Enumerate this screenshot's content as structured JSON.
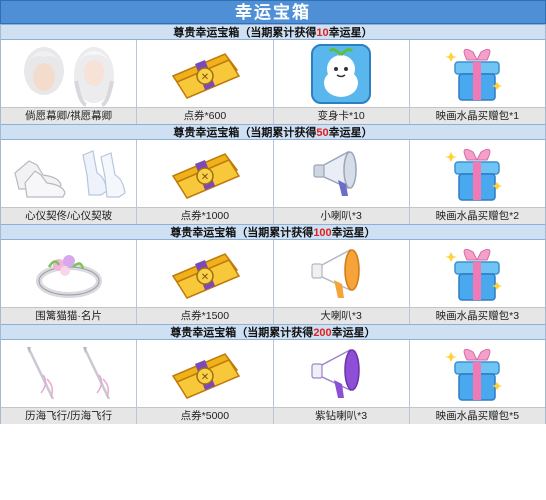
{
  "title": "幸运宝箱",
  "tiers": [
    {
      "header_pre": "尊贵幸运宝箱（当期累计获得",
      "header_num": "10",
      "header_post": "幸运星）",
      "items": [
        {
          "label": "倘愿幕卿/祺愿幕卿",
          "icon": "hair-avatar-icon"
        },
        {
          "label": "点券*600",
          "icon": "gold-voucher-icon"
        },
        {
          "label": "变身卡*10",
          "icon": "transform-card-icon"
        },
        {
          "label": "映画水晶买赠包*1",
          "icon": "gift-box-icon"
        }
      ]
    },
    {
      "header_pre": "尊贵幸运宝箱（当期累计获得",
      "header_num": "50",
      "header_post": "幸运星）",
      "items": [
        {
          "label": "心仪契佟/心仪契玻",
          "icon": "shoes-icon"
        },
        {
          "label": "点券*1000",
          "icon": "gold-voucher-icon"
        },
        {
          "label": "小喇叭*3",
          "icon": "small-megaphone-icon"
        },
        {
          "label": "映画水晶买赠包*2",
          "icon": "gift-box-icon"
        }
      ]
    },
    {
      "header_pre": "尊贵幸运宝箱（当期累计获得",
      "header_num": "100",
      "header_post": "幸运星）",
      "items": [
        {
          "label": "围篱猫猫·名片",
          "icon": "flower-ring-icon"
        },
        {
          "label": "点券*1500",
          "icon": "gold-voucher-icon"
        },
        {
          "label": "大喇叭*3",
          "icon": "large-megaphone-icon"
        },
        {
          "label": "映画水晶买赠包*3",
          "icon": "gift-box-icon"
        }
      ]
    },
    {
      "header_pre": "尊贵幸运宝箱（当期累计获得",
      "header_num": "200",
      "header_post": "幸运星）",
      "items": [
        {
          "label": "历海飞行/历海飞行",
          "icon": "wand-icon"
        },
        {
          "label": "点券*5000",
          "icon": "gold-voucher-icon"
        },
        {
          "label": "紫钻喇叭*3",
          "icon": "purple-megaphone-icon"
        },
        {
          "label": "映画水晶买赠包*5",
          "icon": "gift-box-icon"
        }
      ]
    }
  ],
  "colors": {
    "title_bg": "#4f8fd6",
    "header_bg": "#cfe0f3",
    "highlight": "#e0201c",
    "label_bg": "#e6e6e6"
  }
}
